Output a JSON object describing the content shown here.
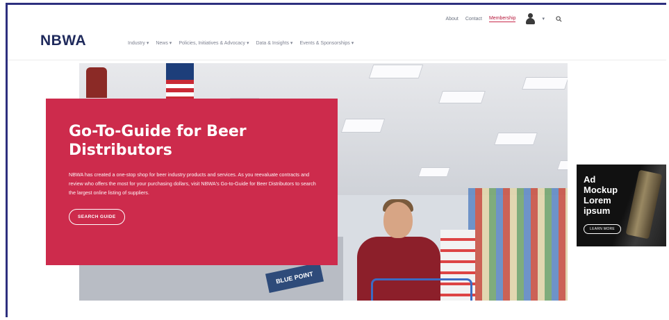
{
  "utility_nav": {
    "about": "About",
    "contact": "Contact",
    "membership": "Membership",
    "account_caret": "▾"
  },
  "header": {
    "logo": "NBWA",
    "nav": [
      "Industry ▾",
      "News ▾",
      "Policies, Initiatives & Advocacy ▾",
      "Data & Insights ▾",
      "Events & Sponsorships ▾"
    ]
  },
  "hero": {
    "title": "Go-To-Guide for Beer Distributors",
    "description": "NBWA has created a one-stop shop for beer industry products and services. As you reevaluate contracts and review who offers the most for your purchasing dollars, visit NBWA's Go-to-Guide for Beer Distributors to search the largest online listing of suppliers.",
    "button": "SEARCH GUIDE",
    "sign_text": "BLUE POINT"
  },
  "ad": {
    "line1": "Ad",
    "line2": "Mockup",
    "line3": "Lorem",
    "line4": "ipsum",
    "button": "LEARN MORE"
  },
  "colors": {
    "brand_red": "#cd2b4c",
    "brand_navy": "#1f2a5c"
  }
}
